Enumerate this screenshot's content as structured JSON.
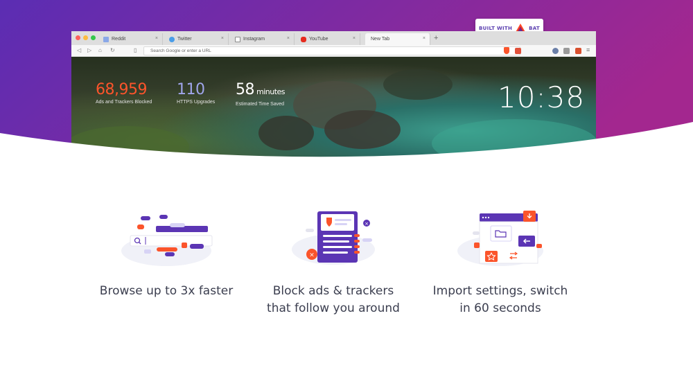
{
  "colors": {
    "gradient_left": "#5b2db3",
    "gradient_right": "#a0278f",
    "brave_orange": "#fb542b",
    "stat_blue": "#a0a5eb",
    "illus_purple": "#5b35b4"
  },
  "badge": {
    "label": "BUILT WITH",
    "brand": "BAT",
    "icon": "bat-triangle-icon"
  },
  "browser": {
    "tabs": [
      {
        "label": "Reddit",
        "icon": "reddit-icon",
        "color": "#8aa8e8"
      },
      {
        "label": "Twitter",
        "icon": "twitter-icon",
        "color": "#4a9de8"
      },
      {
        "label": "Instagram",
        "icon": "instagram-icon",
        "color": "#8a8a8a"
      },
      {
        "label": "YouTube",
        "icon": "youtube-icon",
        "color": "#e62b1e"
      },
      {
        "label": "New Tab",
        "icon": "",
        "color": ""
      }
    ],
    "close_glyph": "×",
    "new_tab_glyph": "+",
    "url_placeholder": "Search Google or enter a URL",
    "nav": {
      "back": "◁",
      "forward": "▷",
      "home": "⌂",
      "reload": "↻",
      "bookmark": "▯"
    },
    "menu_glyph": "≡",
    "ntp": {
      "stats": [
        {
          "value": "68,959",
          "unit": "",
          "label": "Ads and Trackers Blocked",
          "color": "#fb542b"
        },
        {
          "value": "110",
          "unit": "",
          "label": "HTTPS Upgrades",
          "color": "#a0a5eb"
        },
        {
          "value": "58",
          "unit": "minutes",
          "label": "Estimated Time Saved",
          "color": "#ffffff"
        }
      ],
      "clock": "10:38"
    }
  },
  "features": [
    {
      "caption_line1": "Browse up to 3x faster",
      "caption_line2": "",
      "icon": "search-speed-illustration"
    },
    {
      "caption_line1": "Block ads & trackers",
      "caption_line2": "that follow you around",
      "icon": "shield-block-illustration"
    },
    {
      "caption_line1": "Import settings, switch",
      "caption_line2": "in 60 seconds",
      "icon": "import-settings-illustration"
    }
  ]
}
